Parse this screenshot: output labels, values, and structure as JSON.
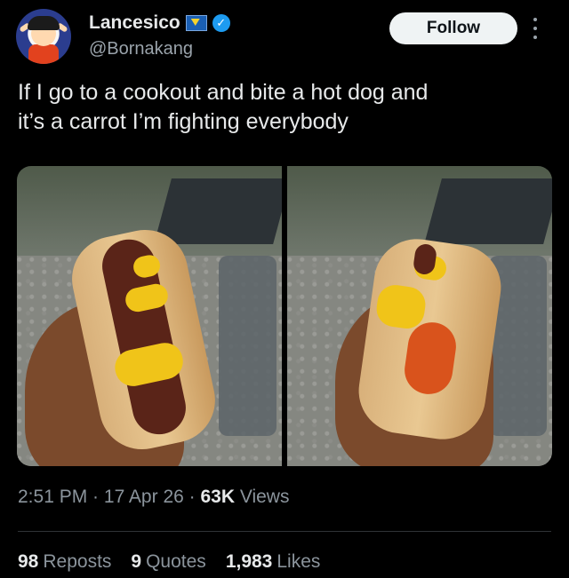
{
  "author": {
    "display_name": "Lancesico",
    "handle": "@Bornakang",
    "flag_icon": "flag-icon",
    "verified_icon": "verified-badge-icon"
  },
  "actions": {
    "follow_label": "Follow",
    "more_icon": "more-options-icon"
  },
  "tweet": {
    "text_line1": "If I go to a cookout and bite a hot dog and",
    "text_line2": "it’s a carrot I’m fighting everybody"
  },
  "meta": {
    "time": "2:51 PM",
    "separator1": " · ",
    "date": "17 Apr 26",
    "separator2": " · ",
    "views_count": "63K",
    "views_label": " Views"
  },
  "stats": {
    "reposts_count": "98",
    "reposts_label": "Reposts",
    "quotes_count": "9",
    "quotes_label": "Quotes",
    "likes_count": "1,983",
    "likes_label": "Likes"
  },
  "colors": {
    "background": "#000000",
    "text": "#e7e9ea",
    "secondary": "#8b949c",
    "verified": "#1d9bf0"
  }
}
